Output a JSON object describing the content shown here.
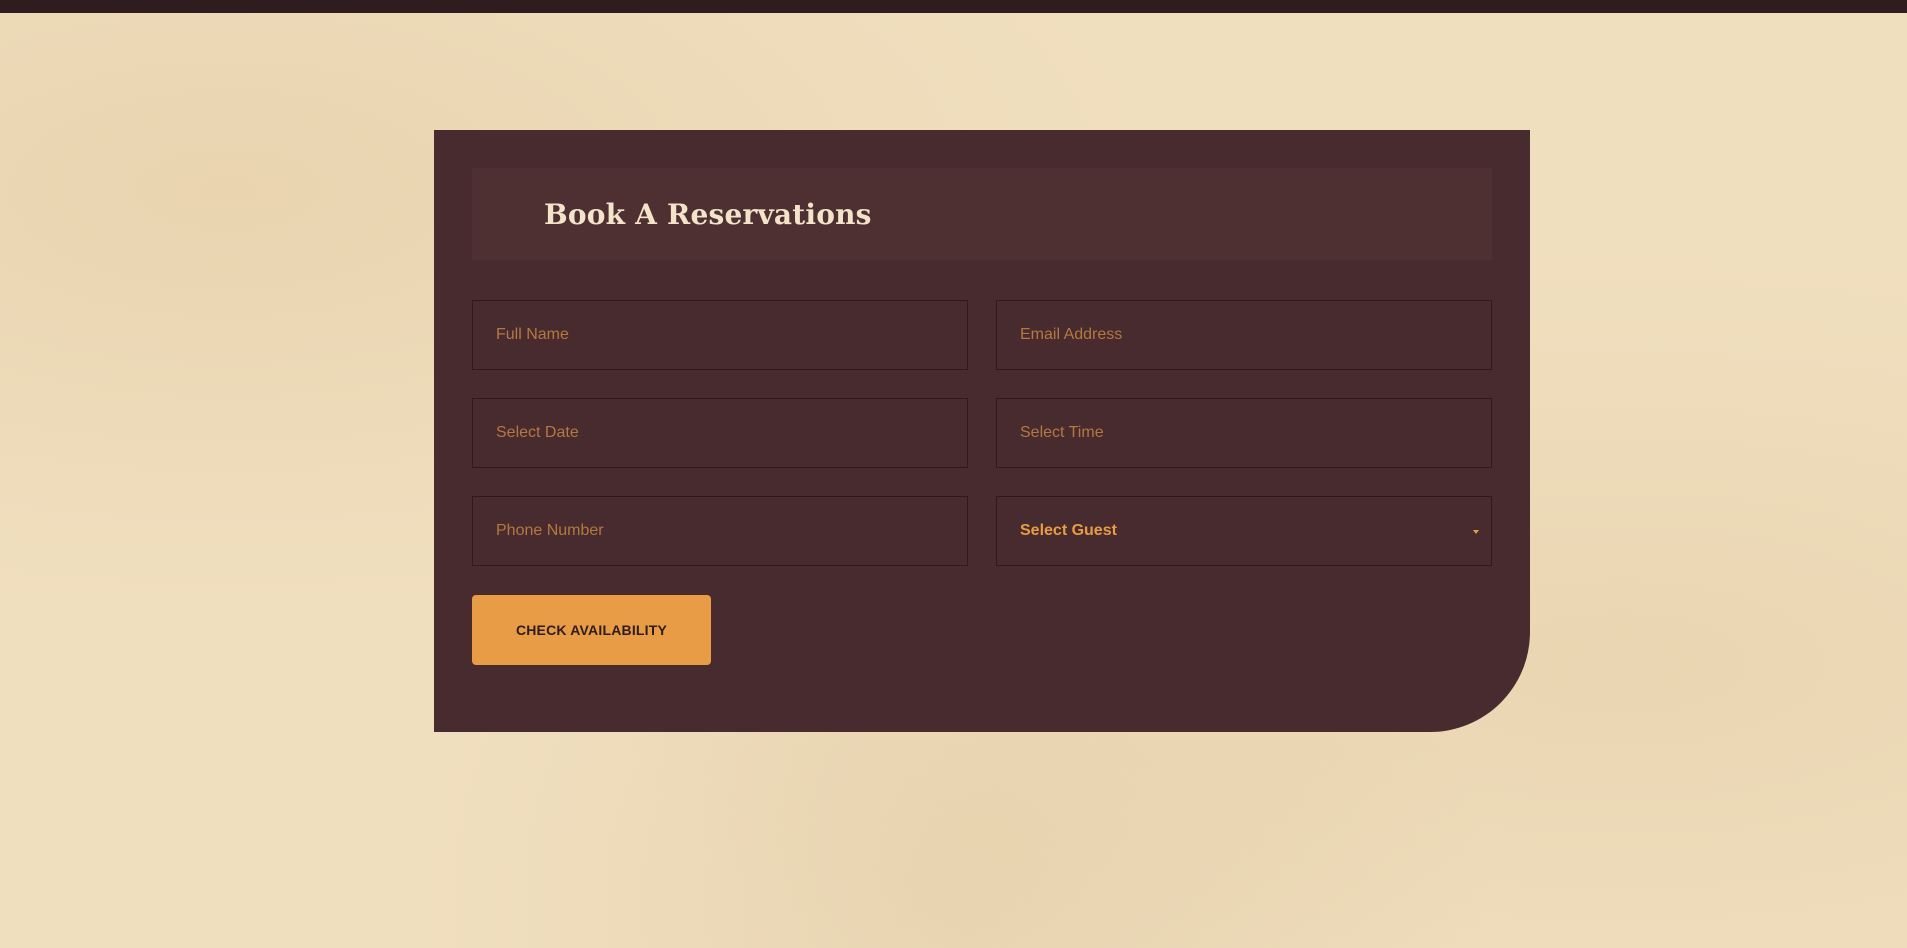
{
  "form": {
    "title": "Book A Reservations",
    "fields": {
      "full_name": {
        "placeholder": "Full Name"
      },
      "email": {
        "placeholder": "Email Address"
      },
      "date": {
        "placeholder": "Select Date"
      },
      "time": {
        "placeholder": "Select Time"
      },
      "phone": {
        "placeholder": "Phone Number"
      },
      "guest": {
        "selected": "Select Guest"
      }
    },
    "submit_label": "CHECK AVAILABILITY"
  },
  "colors": {
    "page_background": "#f0dfbf",
    "top_bar": "#2e1c1f",
    "card_background": "#482b2e",
    "header_background": "#4e3032",
    "title_text": "#f3e3c9",
    "placeholder_text": "#b47840",
    "accent": "#e89c45"
  },
  "icons": {
    "guest_select_caret": "chevron-down-icon"
  }
}
